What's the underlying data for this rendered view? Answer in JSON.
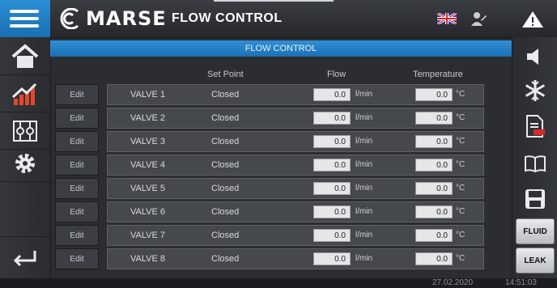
{
  "header": {
    "logo_text": "MARSE",
    "app_title": "FLOW CONTROL"
  },
  "panel": {
    "title": "FLOW CONTROL",
    "columns": {
      "set_point": "Set Point",
      "flow": "Flow",
      "temperature": "Temperature"
    }
  },
  "valves": [
    {
      "edit": "Edit",
      "name": "VALVE 1",
      "set_point": "Closed",
      "flow": "0.0",
      "flow_unit": "l/min",
      "temp": "0.0",
      "temp_unit": "°C"
    },
    {
      "edit": "Edit",
      "name": "VALVE 2",
      "set_point": "Closed",
      "flow": "0.0",
      "flow_unit": "l/min",
      "temp": "0.0",
      "temp_unit": "°C"
    },
    {
      "edit": "Edit",
      "name": "VALVE 3",
      "set_point": "Closed",
      "flow": "0.0",
      "flow_unit": "l/min",
      "temp": "0.0",
      "temp_unit": "°C"
    },
    {
      "edit": "Edit",
      "name": "VALVE 4",
      "set_point": "Closed",
      "flow": "0.0",
      "flow_unit": "l/min",
      "temp": "0.0",
      "temp_unit": "°C"
    },
    {
      "edit": "Edit",
      "name": "VALVE 5",
      "set_point": "Closed",
      "flow": "0.0",
      "flow_unit": "l/min",
      "temp": "0.0",
      "temp_unit": "°C"
    },
    {
      "edit": "Edit",
      "name": "VALVE 6",
      "set_point": "Closed",
      "flow": "0.0",
      "flow_unit": "l/min",
      "temp": "0.0",
      "temp_unit": "°C"
    },
    {
      "edit": "Edit",
      "name": "VALVE 7",
      "set_point": "Closed",
      "flow": "0.0",
      "flow_unit": "l/min",
      "temp": "0.0",
      "temp_unit": "°C"
    },
    {
      "edit": "Edit",
      "name": "VALVE 8",
      "set_point": "Closed",
      "flow": "0.0",
      "flow_unit": "l/min",
      "temp": "0.0",
      "temp_unit": "°C"
    }
  ],
  "right_bar": {
    "fluid_label": "FLUID",
    "leak_label": "LEAK"
  },
  "status": {
    "date": "27.02.2020",
    "time": "14:51:03"
  },
  "colors": {
    "accent": "#1f78c1",
    "background": "#2b2d30",
    "warning": "#ffffff"
  },
  "icons": {
    "left": [
      "home-icon",
      "chart-icon",
      "valves-icon",
      "gear-icon",
      "back-arrow-icon"
    ],
    "right": [
      "speaker-icon",
      "snowflake-icon",
      "pdf-icon",
      "book-icon",
      "save-icon"
    ],
    "top": [
      "menu-icon",
      "uk-flag-icon",
      "user-icon",
      "warning-icon"
    ]
  }
}
